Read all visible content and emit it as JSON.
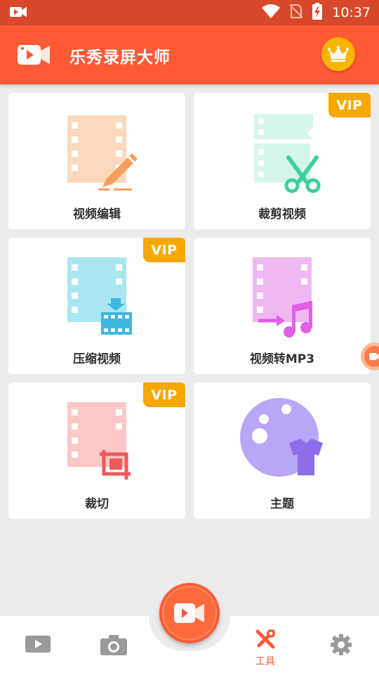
{
  "status_bar": {
    "time": "10:37"
  },
  "app_bar": {
    "title": "乐秀录屏大师"
  },
  "tools": [
    {
      "label": "视频编辑",
      "vip": ""
    },
    {
      "label": "裁剪视频",
      "vip": "VIP"
    },
    {
      "label": "压缩视频",
      "vip": "VIP"
    },
    {
      "label": "视频转MP3",
      "vip": ""
    },
    {
      "label": "裁切",
      "vip": "VIP"
    },
    {
      "label": "主题",
      "vip": ""
    }
  ],
  "bottom_nav": {
    "items": [
      {
        "icon": "video-list-icon",
        "label": ""
      },
      {
        "icon": "camera-icon",
        "label": ""
      },
      {
        "icon": "record-icon",
        "label": ""
      },
      {
        "icon": "tools-icon",
        "label": "工具"
      },
      {
        "icon": "gear-icon",
        "label": ""
      }
    ],
    "active_color": "#ff5a36"
  },
  "colors": {
    "accent": "#ff5a36",
    "status_bar": "#d9482a",
    "vip": "#f7a800"
  }
}
